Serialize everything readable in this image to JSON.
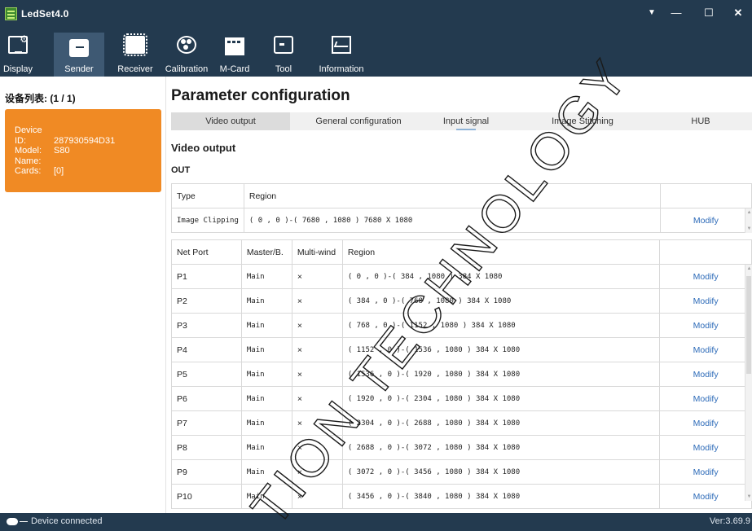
{
  "app": {
    "title": "LedSet4.0",
    "version": "Ver:3.69.9"
  },
  "toolbar": {
    "items": [
      {
        "label": "Display",
        "icon": "display-icon"
      },
      {
        "label": "Sender",
        "icon": "sender-icon",
        "active": true
      },
      {
        "label": "Receiver",
        "icon": "receiver-chip-icon"
      },
      {
        "label": "Calibration",
        "icon": "calibration-icon"
      },
      {
        "label": "M-Card",
        "icon": "mcard-icon"
      },
      {
        "label": "Tool",
        "icon": "tool-icon"
      },
      {
        "label": "Information",
        "icon": "information-icon"
      }
    ]
  },
  "sidebar": {
    "title": "设备列表: (1 / 1)",
    "device": {
      "id_label": "Device ID:",
      "id_value": "287930594D31",
      "model_label": "Model:",
      "model_value": "S80",
      "name_label": "Name:",
      "name_value": "",
      "cards_label": "Cards:",
      "cards_value": "[0]"
    }
  },
  "main": {
    "title": "Parameter configuration",
    "tabs": [
      "Video output",
      "General configuration",
      "Input signal",
      "Image Stitching",
      "HUB"
    ],
    "active_tab": 0,
    "section_title": "Video output",
    "out_label": "OUT",
    "type_table": {
      "headers": [
        "Type",
        "Region"
      ],
      "row": {
        "type": "Image Clipping",
        "region": "( 0 , 0 )-( 7680 , 1080 ) 7680 X 1080",
        "action": "Modify"
      }
    },
    "port_table": {
      "headers": [
        "Net Port",
        "Master/B.",
        "Multi-wind",
        "Region"
      ],
      "rows": [
        {
          "port": "P1",
          "mode": "Main",
          "multi": "×",
          "region": "(    0 ,    0 )-(  384 , 1080 )   384 X 1080",
          "action": "Modify"
        },
        {
          "port": "P2",
          "mode": "Main",
          "multi": "×",
          "region": "(  384 ,    0 )-(  768 , 1080 )   384 X 1080",
          "action": "Modify"
        },
        {
          "port": "P3",
          "mode": "Main",
          "multi": "×",
          "region": "(  768 ,    0 )-( 1152 , 1080 )   384 X 1080",
          "action": "Modify"
        },
        {
          "port": "P4",
          "mode": "Main",
          "multi": "×",
          "region": "( 1152 ,    0 )-( 1536 , 1080 )   384 X 1080",
          "action": "Modify"
        },
        {
          "port": "P5",
          "mode": "Main",
          "multi": "×",
          "region": "( 1536 ,    0 )-( 1920 , 1080 )   384 X 1080",
          "action": "Modify"
        },
        {
          "port": "P6",
          "mode": "Main",
          "multi": "×",
          "region": "( 1920 ,    0 )-( 2304 , 1080 )   384 X 1080",
          "action": "Modify"
        },
        {
          "port": "P7",
          "mode": "Main",
          "multi": "×",
          "region": "( 2304 ,    0 )-( 2688 , 1080 )   384 X 1080",
          "action": "Modify"
        },
        {
          "port": "P8",
          "mode": "Main",
          "multi": "×",
          "region": "( 2688 ,    0 )-( 3072 , 1080 )   384 X 1080",
          "action": "Modify"
        },
        {
          "port": "P9",
          "mode": "Main",
          "multi": "×",
          "region": "( 3072 ,    0 )-( 3456 , 1080 )   384 X 1080",
          "action": "Modify"
        },
        {
          "port": "P10",
          "mode": "Main",
          "multi": "×",
          "region": "( 3456 ,    0 )-( 3840 , 1080 )   384 X 1080",
          "action": "Modify"
        }
      ]
    }
  },
  "status": {
    "text": "Device connected"
  },
  "watermark": {
    "text": "TION TECHNOLOGY"
  },
  "colors": {
    "chrome": "#233a4f",
    "device_card": "#f08a24",
    "link": "#2c6ab8"
  }
}
